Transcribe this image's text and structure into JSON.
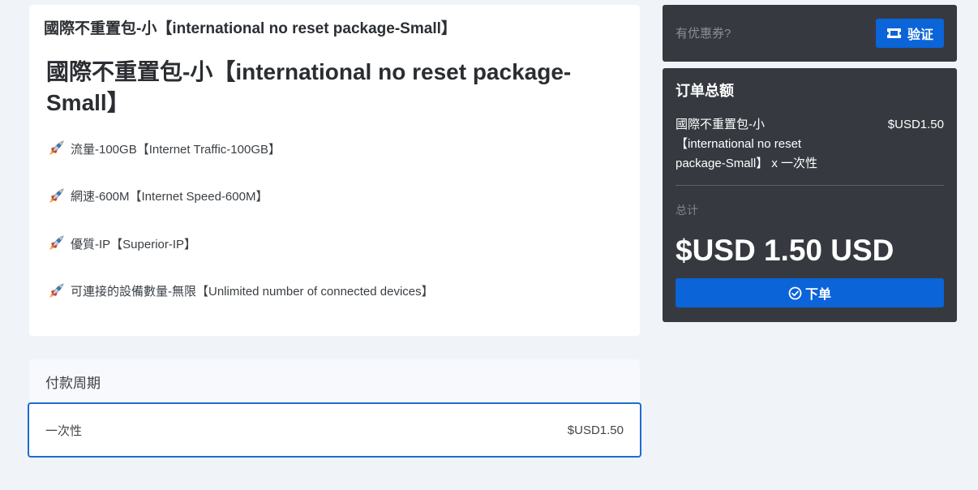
{
  "product": {
    "header_title": "國際不重置包-小【international no reset package-Small】",
    "name": "國際不重置包-小【international no reset package-Small】",
    "features": [
      {
        "icon": "rocket-icon",
        "text": "流量-100GB【Internet Traffic-100GB】"
      },
      {
        "icon": "rocket-icon",
        "text": "網速-600M【Internet Speed-600M】"
      },
      {
        "icon": "rocket-icon",
        "text": "優質-IP【Superior-IP】"
      },
      {
        "icon": "rocket-icon",
        "text": "可連接的設備數量-無限【Unlimited number of connected devices】"
      }
    ]
  },
  "billing_cycle": {
    "label": "付款周期",
    "selected_option": {
      "name": "一次性",
      "price": "$USD1.50"
    }
  },
  "coupon": {
    "placeholder": "有优惠券?",
    "button_label": "验证",
    "button_icon": "ticket-icon"
  },
  "summary": {
    "title": "订单总额",
    "line_item_name": "國際不重置包-小【international no reset package-Small】 x 一次性",
    "line_item_price": "$USD1.50",
    "total_label": "总计",
    "total_amount": "$USD 1.50 USD",
    "order_button_label": "下单",
    "order_button_icon": "check-circle-icon"
  },
  "colors": {
    "accent": "#0b64d8",
    "panel_dark": "#363a40",
    "background": "#f0f3f8",
    "selected_border": "#1b6dd1"
  }
}
